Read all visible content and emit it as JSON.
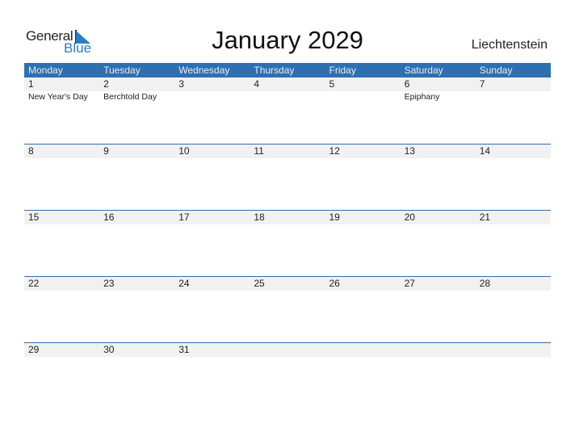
{
  "logo": {
    "text_general": "General",
    "text_blue": "Blue",
    "icon": "flag-triangle-icon"
  },
  "title": "January 2029",
  "country": "Liechtenstein",
  "colors": {
    "header_bg": "#2e6fb0",
    "logo_blue": "#2a7cc7",
    "date_strip_bg": "#f1f1f1"
  },
  "weekdays": [
    "Monday",
    "Tuesday",
    "Wednesday",
    "Thursday",
    "Friday",
    "Saturday",
    "Sunday"
  ],
  "weeks": [
    {
      "days": [
        "1",
        "2",
        "3",
        "4",
        "5",
        "6",
        "7"
      ],
      "holidays": [
        "New Year's Day",
        "Berchtold Day",
        "",
        "",
        "",
        "Epiphany",
        ""
      ]
    },
    {
      "days": [
        "8",
        "9",
        "10",
        "11",
        "12",
        "13",
        "14"
      ],
      "holidays": [
        "",
        "",
        "",
        "",
        "",
        "",
        ""
      ]
    },
    {
      "days": [
        "15",
        "16",
        "17",
        "18",
        "19",
        "20",
        "21"
      ],
      "holidays": [
        "",
        "",
        "",
        "",
        "",
        "",
        ""
      ]
    },
    {
      "days": [
        "22",
        "23",
        "24",
        "25",
        "26",
        "27",
        "28"
      ],
      "holidays": [
        "",
        "",
        "",
        "",
        "",
        "",
        ""
      ]
    },
    {
      "days": [
        "29",
        "30",
        "31",
        "",
        "",
        "",
        ""
      ],
      "holidays": [
        "",
        "",
        "",
        "",
        "",
        "",
        ""
      ]
    }
  ]
}
